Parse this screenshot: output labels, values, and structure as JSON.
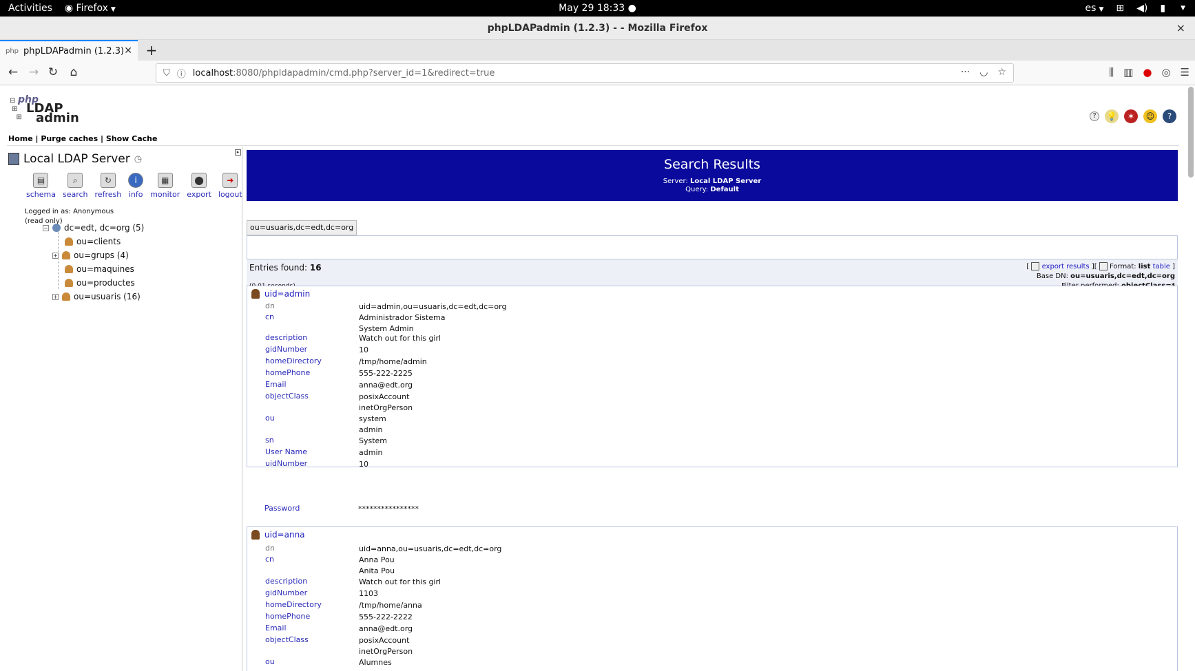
{
  "gnome": {
    "activities": "Activities",
    "app": "Firefox",
    "clock": "May 29  18:33",
    "lang": "es"
  },
  "window": {
    "title": "phpLDAPadmin (1.2.3) - - Mozilla Firefox",
    "close": "×"
  },
  "tabs": [
    {
      "label": "phpLDAPadmin (1.2.3) -",
      "favicon": "php"
    }
  ],
  "nav": {
    "url_host": "localhost",
    "url_path": ":8080/phpldapadmin/cmd.php?server_id=1&redirect=true"
  },
  "topmenu": {
    "home": "Home",
    "purge": "Purge caches",
    "cache": "Show Cache",
    "sep": " | "
  },
  "logo": {
    "php": "php",
    "ldap": "LDAP",
    "admin": "admin"
  },
  "server": {
    "name": "Local LDAP Server",
    "actions": [
      {
        "label": "schema",
        "icon": "schema-icon"
      },
      {
        "label": "search",
        "icon": "search-icon"
      },
      {
        "label": "refresh",
        "icon": "refresh-icon"
      },
      {
        "label": "info",
        "icon": "info-icon"
      },
      {
        "label": "monitor",
        "icon": "monitor-icon"
      },
      {
        "label": "export",
        "icon": "export-icon"
      },
      {
        "label": "logout",
        "icon": "logout-icon"
      }
    ],
    "logged_in": "Logged in as: Anonymous",
    "read_only": "(read only)"
  },
  "tree": {
    "root": "dc=edt, dc=org (5)",
    "children": [
      {
        "label": "ou=clients",
        "expandable": false
      },
      {
        "label": "ou=grups (4)",
        "expandable": true
      },
      {
        "label": "ou=maquines",
        "expandable": false
      },
      {
        "label": "ou=productes",
        "expandable": false
      },
      {
        "label": "ou=usuaris (16)",
        "expandable": true
      }
    ]
  },
  "search": {
    "title": "Search Results",
    "server_label": "Server:",
    "server_value": "Local LDAP Server",
    "query_label": "Query:",
    "query_value": "Default",
    "base_tab": "ou=usuaris,dc=edt,dc=org",
    "entries_label": "Entries found:",
    "entries_count": "16",
    "time": "(0.01 seconds)",
    "export_results": "export results",
    "format_label": "Format:",
    "format_list": "list",
    "format_table": "table",
    "base_dn_label": "Base DN:",
    "base_dn": "ou=usuaris,dc=edt,dc=org",
    "filter_label": "Filter performed:",
    "filter": "objectClass=*"
  },
  "entries": [
    {
      "title": "uid=admin",
      "attrs": [
        {
          "name": "dn",
          "values": [
            "uid=admin,ou=usuaris,dc=edt,dc=org"
          ]
        },
        {
          "name": "cn",
          "values": [
            "Administrador Sistema",
            "System Admin"
          ]
        },
        {
          "name": "description",
          "values": [
            "Watch out for this girl"
          ]
        },
        {
          "name": "gidNumber",
          "values": [
            "10"
          ]
        },
        {
          "name": "homeDirectory",
          "values": [
            "/tmp/home/admin"
          ]
        },
        {
          "name": "homePhone",
          "values": [
            "555-222-2225"
          ]
        },
        {
          "name": "Email",
          "values": [
            "anna@edt.org"
          ]
        },
        {
          "name": "objectClass",
          "values": [
            "posixAccount",
            "inetOrgPerson"
          ]
        },
        {
          "name": "ou",
          "values": [
            "system",
            "admin"
          ]
        },
        {
          "name": "sn",
          "values": [
            "System"
          ]
        },
        {
          "name": "User Name",
          "values": [
            "admin"
          ]
        },
        {
          "name": "uidNumber",
          "values": [
            "10"
          ]
        },
        {
          "name": "Password",
          "values": [
            "****************"
          ]
        }
      ]
    },
    {
      "title": "uid=anna",
      "attrs": [
        {
          "name": "dn",
          "values": [
            "uid=anna,ou=usuaris,dc=edt,dc=org"
          ]
        },
        {
          "name": "cn",
          "values": [
            "Anna Pou",
            "Anita Pou"
          ]
        },
        {
          "name": "description",
          "values": [
            "Watch out for this girl"
          ]
        },
        {
          "name": "gidNumber",
          "values": [
            "1103"
          ]
        },
        {
          "name": "homeDirectory",
          "values": [
            "/tmp/home/anna"
          ]
        },
        {
          "name": "homePhone",
          "values": [
            "555-222-2222"
          ]
        },
        {
          "name": "Email",
          "values": [
            "anna@edt.org"
          ]
        },
        {
          "name": "objectClass",
          "values": [
            "posixAccount",
            "inetOrgPerson"
          ]
        },
        {
          "name": "ou",
          "values": [
            "Alumnes"
          ]
        }
      ]
    }
  ]
}
